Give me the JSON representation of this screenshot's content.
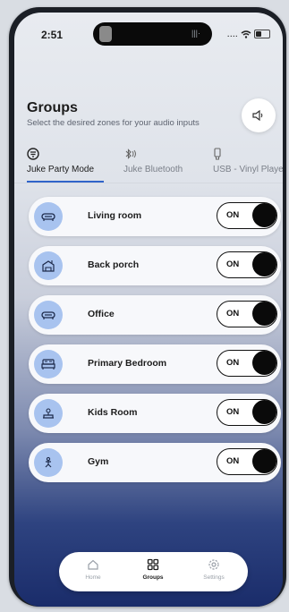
{
  "status_bar": {
    "time": "2:51",
    "signal": "...."
  },
  "header": {
    "title": "Groups",
    "subtitle": "Select the desired zones for your audio inputs"
  },
  "tabs": [
    {
      "label": "Juke Party Mode",
      "icon": "party-icon",
      "active": true
    },
    {
      "label": "Juke Bluetooth",
      "icon": "bluetooth-icon",
      "active": false
    },
    {
      "label": "USB - Vinyl Playe",
      "icon": "usb-icon",
      "active": false
    }
  ],
  "zones": [
    {
      "name": "Living room",
      "icon": "sofa-icon",
      "toggle": "ON"
    },
    {
      "name": "Back porch",
      "icon": "porch-icon",
      "toggle": "ON"
    },
    {
      "name": "Office",
      "icon": "sofa-icon",
      "toggle": "ON"
    },
    {
      "name": "Primary Bedroom",
      "icon": "bed-icon",
      "toggle": "ON"
    },
    {
      "name": "Kids Room",
      "icon": "kids-room-icon",
      "toggle": "ON"
    },
    {
      "name": "Gym",
      "icon": "gym-icon",
      "toggle": "ON"
    }
  ],
  "bottom_nav": [
    {
      "label": "Home",
      "icon": "home-icon",
      "active": false
    },
    {
      "label": "Groups",
      "icon": "grid-icon",
      "active": true
    },
    {
      "label": "Settings",
      "icon": "gear-icon",
      "active": false
    }
  ],
  "colors": {
    "accent": "#2f63c9",
    "zone_icon_bg": "#a8c3ef",
    "toggle_knob": "#0a0a0a"
  }
}
